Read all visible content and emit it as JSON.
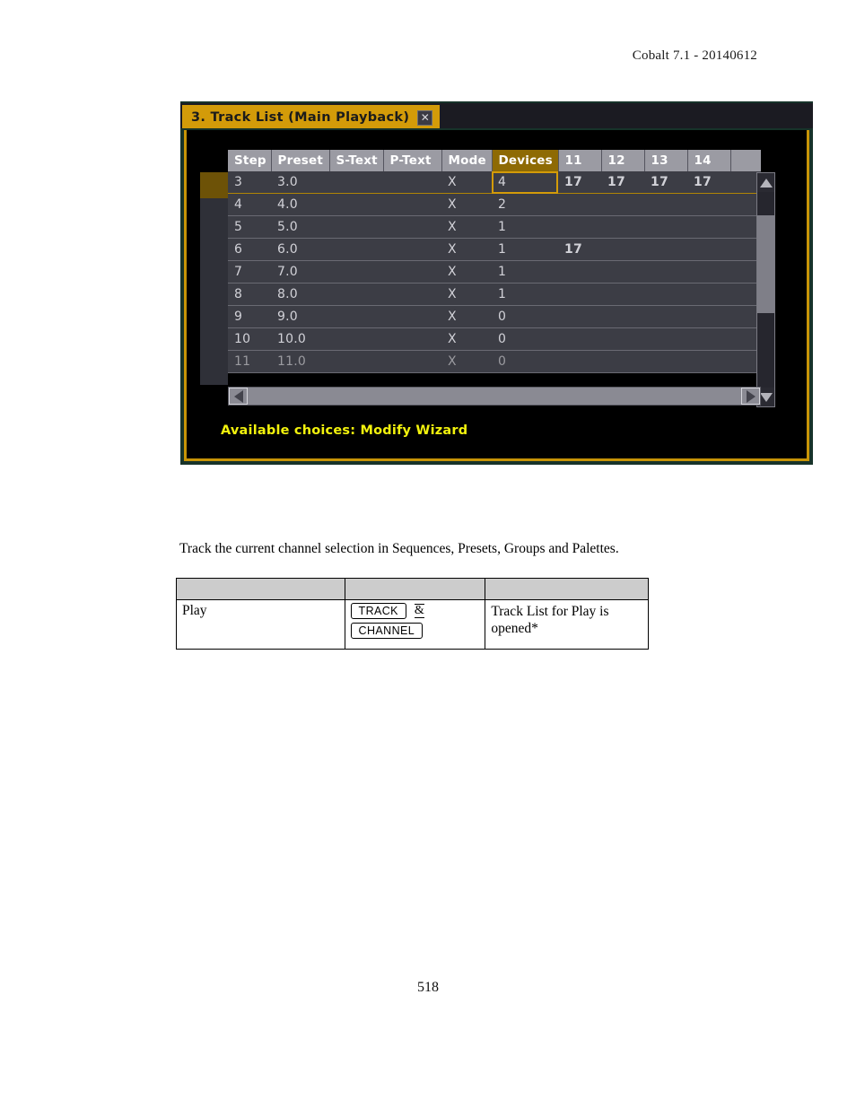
{
  "page_header": "Cobalt 7.1 - 20140612",
  "page_number": "518",
  "dialog": {
    "title": "3. Track List (Main Playback)",
    "close_icon": "close-icon",
    "status_text": "Available choices: Modify Wizard",
    "accent_gold": "#d39b09",
    "header_gold": "#8e6a04",
    "status_yellow": "#f2f20d",
    "grid": {
      "columns": [
        "Step",
        "Preset",
        "S-Text",
        "P-Text",
        "Mode",
        "Devices",
        "11",
        "12",
        "13",
        "14",
        ""
      ],
      "highlighted_column": "Devices",
      "selected_row_index": 0,
      "focused_cell": {
        "row": 0,
        "column": "Devices"
      },
      "rows": [
        {
          "step": "3",
          "preset": "3.0",
          "s_text": "",
          "p_text": "",
          "mode": "X",
          "devices": "4",
          "c11": "17",
          "c12": "17",
          "c13": "17",
          "c14": "17",
          "c15": ""
        },
        {
          "step": "4",
          "preset": "4.0",
          "s_text": "",
          "p_text": "",
          "mode": "X",
          "devices": "2",
          "c11": "",
          "c12": "",
          "c13": "",
          "c14": "",
          "c15": ""
        },
        {
          "step": "5",
          "preset": "5.0",
          "s_text": "",
          "p_text": "",
          "mode": "X",
          "devices": "1",
          "c11": "",
          "c12": "",
          "c13": "",
          "c14": "",
          "c15": ""
        },
        {
          "step": "6",
          "preset": "6.0",
          "s_text": "",
          "p_text": "",
          "mode": "X",
          "devices": "1",
          "c11": "17",
          "c12": "",
          "c13": "",
          "c14": "",
          "c15": ""
        },
        {
          "step": "7",
          "preset": "7.0",
          "s_text": "",
          "p_text": "",
          "mode": "X",
          "devices": "1",
          "c11": "",
          "c12": "",
          "c13": "",
          "c14": "",
          "c15": ""
        },
        {
          "step": "8",
          "preset": "8.0",
          "s_text": "",
          "p_text": "",
          "mode": "X",
          "devices": "1",
          "c11": "",
          "c12": "",
          "c13": "",
          "c14": "",
          "c15": ""
        },
        {
          "step": "9",
          "preset": "9.0",
          "s_text": "",
          "p_text": "",
          "mode": "X",
          "devices": "0",
          "c11": "",
          "c12": "",
          "c13": "",
          "c14": "",
          "c15": ""
        },
        {
          "step": "10",
          "preset": "10.0",
          "s_text": "",
          "p_text": "",
          "mode": "X",
          "devices": "0",
          "c11": "",
          "c12": "",
          "c13": "",
          "c14": "",
          "c15": ""
        },
        {
          "step": "11",
          "preset": "11.0",
          "s_text": "",
          "p_text": "",
          "mode": "X",
          "devices": "0",
          "c11": "",
          "c12": "",
          "c13": "",
          "c14": "",
          "c15": ""
        }
      ]
    },
    "scrollbars": {
      "vertical": {
        "up_icon": "scroll-up-arrow-icon",
        "down_icon": "scroll-down-arrow-icon"
      },
      "horizontal": {
        "left_icon": "scroll-left-arrow-icon",
        "right_icon": "scroll-right-arrow-icon"
      }
    }
  },
  "body_paragraph": "Track the current channel selection in Sequences, Presets, Groups and Palettes.",
  "key_table": {
    "header": [
      "",
      "",
      ""
    ],
    "rows": [
      {
        "context": "Play",
        "keys": [
          "TRACK",
          "CHANNEL"
        ],
        "separator": "&",
        "result": "Track List for Play is opened*"
      }
    ]
  }
}
